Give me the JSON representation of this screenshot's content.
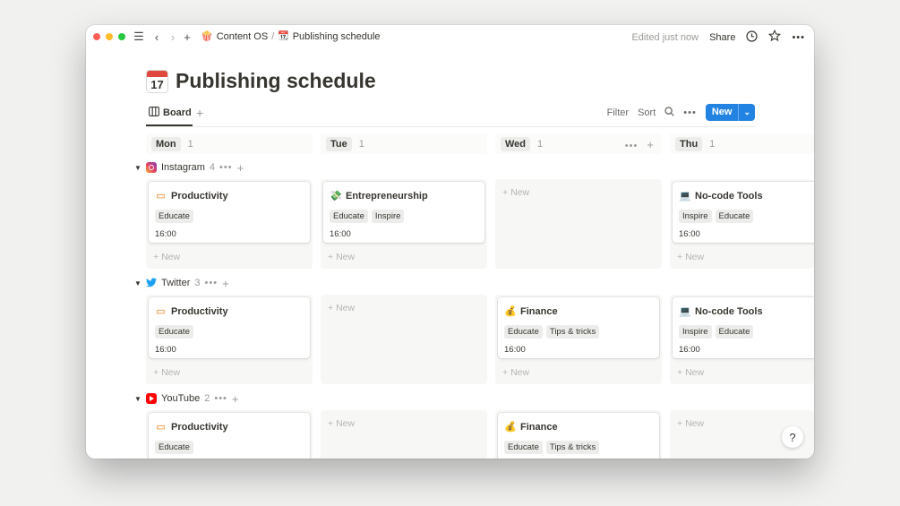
{
  "topbar": {
    "breadcrumbs": [
      "Content OS",
      "Publishing schedule"
    ],
    "separator": "/",
    "edited": "Edited just now",
    "share": "Share"
  },
  "page": {
    "title": "Publishing schedule",
    "icon_text": "17"
  },
  "viewbar": {
    "tab_label": "Board",
    "filter": "Filter",
    "sort": "Sort",
    "new_label": "New"
  },
  "columns": [
    {
      "label": "Mon",
      "count": "1"
    },
    {
      "label": "Tue",
      "count": "1"
    },
    {
      "label": "Wed",
      "count": "1"
    },
    {
      "label": "Thu",
      "count": "1"
    }
  ],
  "groups": [
    {
      "name": "Instagram",
      "count": "4",
      "icon": "instagram-icon"
    },
    {
      "name": "Twitter",
      "count": "3",
      "icon": "twitter-icon"
    },
    {
      "name": "YouTube",
      "count": "2",
      "icon": "youtube-icon"
    }
  ],
  "cards": {
    "productivity": {
      "title": "Productivity",
      "tags": [
        "Educate"
      ],
      "time": "16:00",
      "icon": "pencil-icon"
    },
    "entrepreneurship": {
      "title": "Entrepreneurship",
      "tags": [
        "Educate",
        "Inspire"
      ],
      "time": "16:00",
      "icon": "money-icon"
    },
    "nocode": {
      "title": "No-code Tools",
      "tags": [
        "Inspire",
        "Educate"
      ],
      "time": "16:00",
      "icon": "laptop-icon"
    },
    "finance": {
      "title": "Finance",
      "tags": [
        "Educate",
        "Tips & tricks"
      ],
      "time": "16:00",
      "icon": "money-bag-icon"
    }
  },
  "new_label": "New",
  "help_label": "?",
  "colors": {
    "accent": "#2383e2",
    "cell_bg": "#f7f7f5"
  }
}
